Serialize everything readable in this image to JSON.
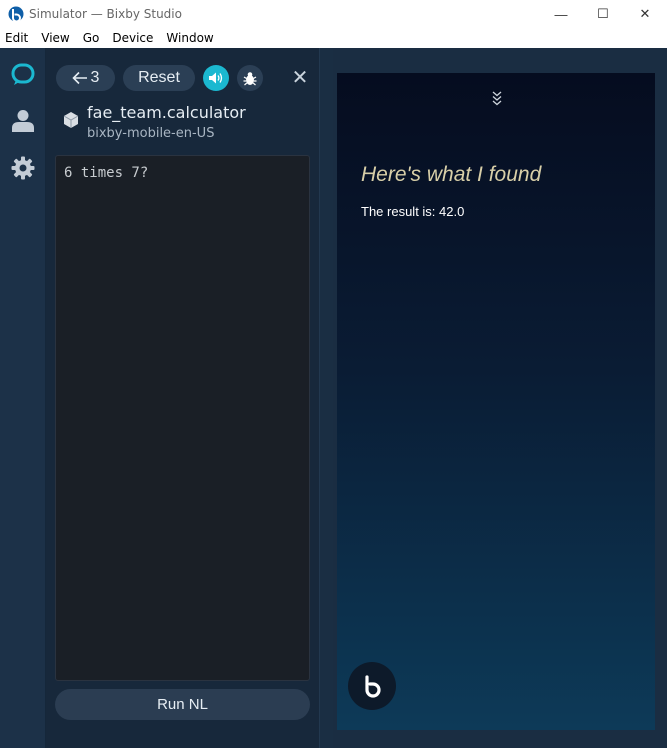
{
  "window": {
    "title": "Simulator — Bixby Studio",
    "minimize_glyph": "—",
    "maximize_glyph": "☐",
    "close_glyph": "✕"
  },
  "menu": [
    "Edit",
    "View",
    "Go",
    "Device",
    "Window"
  ],
  "rail": {
    "icons": [
      "bixby-chat-icon",
      "user-icon",
      "gear-icon"
    ]
  },
  "toolbar": {
    "back_label": "3",
    "reset_label": "Reset",
    "sound_icon": "speaker-icon",
    "debug_icon": "bug-icon",
    "close_glyph": "✕"
  },
  "capsule": {
    "name": "fae_team.calculator",
    "target": "bixby-mobile-en-US"
  },
  "editor": {
    "text": "6 times 7?"
  },
  "run_button": "Run NL",
  "device": {
    "heading": "Here's what I found",
    "result": "The result is: 42.0"
  },
  "colors": {
    "accent": "#1bb8d0",
    "panel": "#17283b",
    "heading_text": "#d8cfa8"
  }
}
